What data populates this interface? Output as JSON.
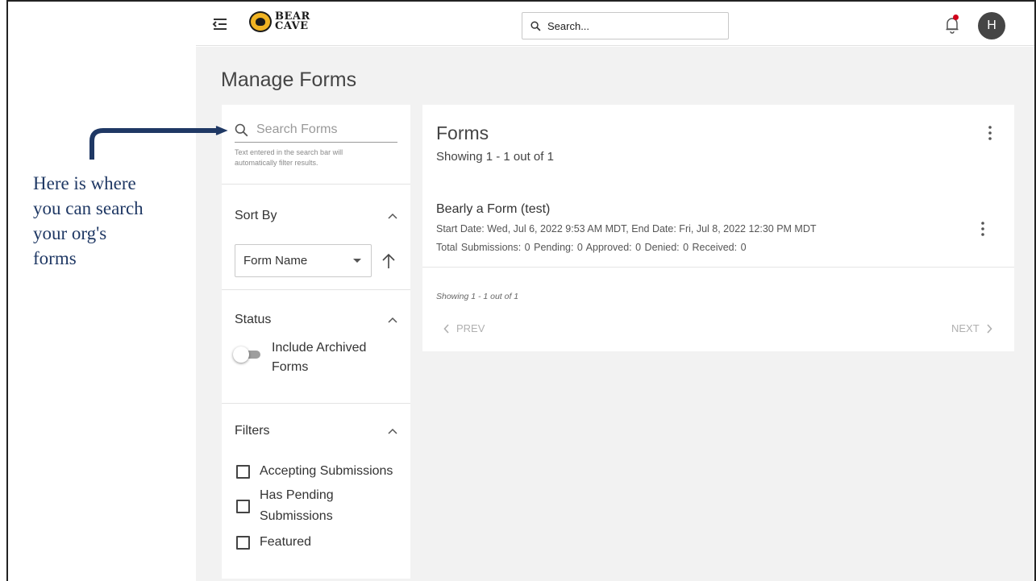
{
  "app": {
    "logo_text_line1": "BEAR",
    "logo_text_line2": "CAVE",
    "search_placeholder": "Search...",
    "avatar_initial": "H",
    "accent_color": "#f0b323",
    "notification_dot_color": "#d0021b"
  },
  "page": {
    "title": "Manage Forms"
  },
  "sidebar": {
    "search_placeholder": "Search Forms",
    "search_hint_line1": "Text entered in the search bar will",
    "search_hint_line2": "automatically filter results.",
    "sort": {
      "heading": "Sort By",
      "selected_option": "Form Name"
    },
    "status": {
      "heading": "Status",
      "toggle_label": "Include Archived Forms",
      "toggle_on": false
    },
    "filters": {
      "heading": "Filters",
      "options": [
        {
          "label_line1": "Accepting Submissions",
          "label_line2": "",
          "checked": false
        },
        {
          "label_line1": "Has Pending",
          "label_line2": "Submissions",
          "checked": false
        },
        {
          "label_line1": "Featured",
          "label_line2": "",
          "checked": false
        }
      ]
    }
  },
  "main": {
    "title": "Forms",
    "count": "Showing 1 - 1 out of 1",
    "forms": [
      {
        "name": "Bearly a Form (test)",
        "dates": "Start Date: Wed, Jul 6, 2022 9:53 AM MDT, End Date: Fri, Jul 8, 2022 12:30 PM MDT",
        "stats": "Total Submissions: 0   Pending: 0   Approved: 0   Denied: 0   Received: 0"
      }
    ],
    "footer_count": "Showing 1 - 1 out of 1",
    "prev_label": "PREV",
    "next_label": "NEXT"
  },
  "annotation": {
    "line1": "Here is where",
    "line2": "you can search",
    "line3": "your org's",
    "line4": "forms",
    "color": "#1f3864"
  }
}
